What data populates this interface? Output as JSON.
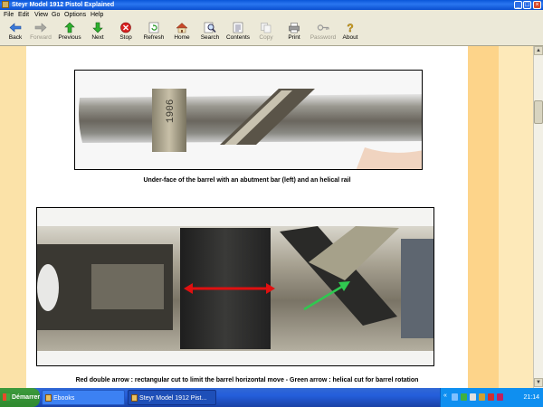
{
  "window": {
    "title": "Steyr Model 1912 Pistol Explained"
  },
  "menu": [
    "File",
    "Edit",
    "View",
    "Go",
    "Options",
    "Help"
  ],
  "toolbar": {
    "back": "Back",
    "forward": "Forward",
    "previous": "Previous",
    "next": "Next",
    "stop": "Stop",
    "refresh": "Refresh",
    "home": "Home",
    "search": "Search",
    "contents": "Contents",
    "copy": "Copy",
    "print": "Print",
    "password": "Password",
    "about": "About"
  },
  "photo1": {
    "stamp": "1906"
  },
  "captions": {
    "first": "Under-face of the barrel with an abutment bar (left) and an helical rail",
    "second": "Red double arrow : rectangular cut to limit the barrel horizontal move - Green arrow : helical cut for barrel rotation"
  },
  "taskbar": {
    "start": "Démarrer",
    "tasks": [
      "Ebooks",
      "Steyr Model 1912 Pist..."
    ],
    "clock": "21:14"
  },
  "colors": {
    "arrow_red": "#e01010",
    "arrow_green": "#30c850",
    "page_bg": "#fbe2a8"
  }
}
